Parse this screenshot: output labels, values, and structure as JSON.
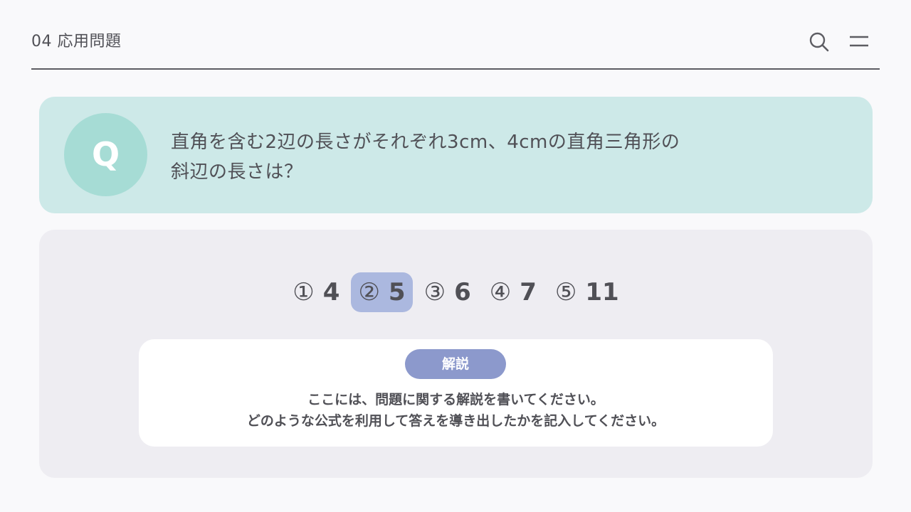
{
  "header": {
    "title": "04 応用問題",
    "search_icon": "search-icon",
    "menu_icon": "menu-icon"
  },
  "question": {
    "badge": "Q",
    "text": "直角を含む2辺の長さがそれぞれ3cm、4cmの直角三角形の斜辺の長さは？"
  },
  "choices": [
    {
      "num": "①",
      "value": "4",
      "selected": false
    },
    {
      "num": "②",
      "value": "5",
      "selected": true
    },
    {
      "num": "③",
      "value": "6",
      "selected": false
    },
    {
      "num": "④",
      "value": "7",
      "selected": false
    },
    {
      "num": "⑤",
      "value": "11",
      "selected": false
    }
  ],
  "explanation": {
    "label": "解説",
    "lines": [
      "ここには、問題に関する解説を書いてください。",
      "どのような公式を利用して答えを導き出したかを記入してください。"
    ]
  },
  "colors": {
    "background": "#f9f9fb",
    "question_card": "#cde9e8",
    "q_badge": "#a6dcd5",
    "answer_panel": "#eeedf2",
    "selected_choice": "#abb8df",
    "explain_label": "#8c99cc",
    "text": "#505056"
  }
}
